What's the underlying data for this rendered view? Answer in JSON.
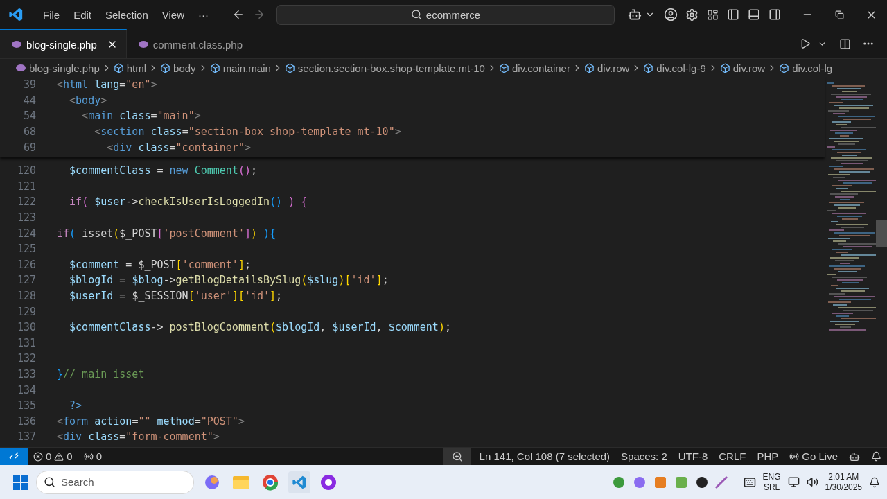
{
  "menu": [
    "File",
    "Edit",
    "Selection",
    "View",
    "···"
  ],
  "command_center": {
    "value": "ecommerce"
  },
  "tabs": [
    {
      "label": "blog-single.php",
      "selected": true
    },
    {
      "label": "comment.class.php",
      "selected": false
    }
  ],
  "breadcrumbs": [
    {
      "label": "blog-single.php",
      "kind": "file"
    },
    {
      "label": "html",
      "kind": "element"
    },
    {
      "label": "body",
      "kind": "element"
    },
    {
      "label": "main.main",
      "kind": "element"
    },
    {
      "label": "section.section-box.shop-template.mt-10",
      "kind": "element"
    },
    {
      "label": "div.container",
      "kind": "element"
    },
    {
      "label": "div.row",
      "kind": "element"
    },
    {
      "label": "div.col-lg-9",
      "kind": "element"
    },
    {
      "label": "div.row",
      "kind": "element"
    },
    {
      "label": "div.col-lg",
      "kind": "element"
    }
  ],
  "sticky_lines": [
    {
      "number": "39",
      "tokens": [
        {
          "text": "<",
          "kind": "tagp"
        },
        {
          "text": "html ",
          "kind": "tag"
        },
        {
          "text": "lang",
          "kind": "attr"
        },
        {
          "text": "=",
          "kind": "plain"
        },
        {
          "text": "\"en\"",
          "kind": "str"
        },
        {
          "text": ">",
          "kind": "tagp"
        }
      ]
    },
    {
      "number": "44",
      "tokens": [
        {
          "text": "  <",
          "kind": "tagp"
        },
        {
          "text": "body",
          "kind": "tag"
        },
        {
          "text": ">",
          "kind": "tagp"
        }
      ]
    },
    {
      "number": "54",
      "tokens": [
        {
          "text": "    <",
          "kind": "tagp"
        },
        {
          "text": "main ",
          "kind": "tag"
        },
        {
          "text": "class",
          "kind": "attr"
        },
        {
          "text": "=",
          "kind": "plain"
        },
        {
          "text": "\"main\"",
          "kind": "str"
        },
        {
          "text": ">",
          "kind": "tagp"
        }
      ]
    },
    {
      "number": "68",
      "tokens": [
        {
          "text": "      <",
          "kind": "tagp"
        },
        {
          "text": "section ",
          "kind": "tag"
        },
        {
          "text": "class",
          "kind": "attr"
        },
        {
          "text": "=",
          "kind": "plain"
        },
        {
          "text": "\"section-box shop-template mt-10\"",
          "kind": "str"
        },
        {
          "text": ">",
          "kind": "tagp"
        }
      ]
    },
    {
      "number": "69",
      "tokens": [
        {
          "text": "        <",
          "kind": "tagp"
        },
        {
          "text": "div ",
          "kind": "tag"
        },
        {
          "text": "class",
          "kind": "attr"
        },
        {
          "text": "=",
          "kind": "plain"
        },
        {
          "text": "\"container\"",
          "kind": "str"
        },
        {
          "text": ">",
          "kind": "tagp"
        }
      ]
    }
  ],
  "lines": [
    {
      "number": "120",
      "tokens": [
        {
          "text": "  $commentClass",
          "kind": "var"
        },
        {
          "text": " = ",
          "kind": "plain"
        },
        {
          "text": "new ",
          "kind": "kw"
        },
        {
          "text": "Comment",
          "kind": "cls"
        },
        {
          "text": "()",
          "kind": "b2"
        },
        {
          "text": ";",
          "kind": "plain"
        }
      ]
    },
    {
      "number": "121"
    },
    {
      "number": "122",
      "tokens": [
        {
          "text": "  if",
          "kind": "ctrl"
        },
        {
          "text": "( ",
          "kind": "b2"
        },
        {
          "text": "$user",
          "kind": "var"
        },
        {
          "text": "->",
          "kind": "plain"
        },
        {
          "text": "checkIsUserIsLoggedIn",
          "kind": "fn"
        },
        {
          "text": "() ",
          "kind": "b3"
        },
        {
          "text": ") {",
          "kind": "b2"
        }
      ]
    },
    {
      "number": "123"
    },
    {
      "number": "124",
      "tokens": [
        {
          "text": "if",
          "kind": "ctrl"
        },
        {
          "text": "( ",
          "kind": "b3"
        },
        {
          "text": "isset",
          "kind": "plain"
        },
        {
          "text": "(",
          "kind": "b1"
        },
        {
          "text": "$_POST",
          "kind": "plain"
        },
        {
          "text": "[",
          "kind": "b2"
        },
        {
          "text": "'postComment'",
          "kind": "str"
        },
        {
          "text": "]",
          "kind": "b2"
        },
        {
          "text": ") ",
          "kind": "b1"
        },
        {
          "text": "){",
          "kind": "b3"
        }
      ]
    },
    {
      "number": "125"
    },
    {
      "number": "126",
      "tokens": [
        {
          "text": "  $comment",
          "kind": "var"
        },
        {
          "text": " = ",
          "kind": "plain"
        },
        {
          "text": "$_POST",
          "kind": "plain"
        },
        {
          "text": "[",
          "kind": "b1"
        },
        {
          "text": "'comment'",
          "kind": "str"
        },
        {
          "text": "]",
          "kind": "b1"
        },
        {
          "text": ";",
          "kind": "plain"
        }
      ]
    },
    {
      "number": "127",
      "tokens": [
        {
          "text": "  $blogId",
          "kind": "var"
        },
        {
          "text": " = ",
          "kind": "plain"
        },
        {
          "text": "$blog",
          "kind": "var"
        },
        {
          "text": "->",
          "kind": "plain"
        },
        {
          "text": "getBlogDetailsBySlug",
          "kind": "fn"
        },
        {
          "text": "(",
          "kind": "b1"
        },
        {
          "text": "$slug",
          "kind": "var"
        },
        {
          "text": ")",
          "kind": "b1"
        },
        {
          "text": "[",
          "kind": "b1"
        },
        {
          "text": "'id'",
          "kind": "str"
        },
        {
          "text": "]",
          "kind": "b1"
        },
        {
          "text": ";",
          "kind": "plain"
        }
      ]
    },
    {
      "number": "128",
      "tokens": [
        {
          "text": "  $userId",
          "kind": "var"
        },
        {
          "text": " = ",
          "kind": "plain"
        },
        {
          "text": "$_SESSION",
          "kind": "plain"
        },
        {
          "text": "[",
          "kind": "b1"
        },
        {
          "text": "'user'",
          "kind": "str"
        },
        {
          "text": "]",
          "kind": "b1"
        },
        {
          "text": "[",
          "kind": "b1"
        },
        {
          "text": "'id'",
          "kind": "str"
        },
        {
          "text": "]",
          "kind": "b1"
        },
        {
          "text": ";",
          "kind": "plain"
        }
      ]
    },
    {
      "number": "129"
    },
    {
      "number": "130",
      "tokens": [
        {
          "text": "  $commentClass",
          "kind": "var"
        },
        {
          "text": "-> ",
          "kind": "plain"
        },
        {
          "text": "postBlogCoomment",
          "kind": "fn"
        },
        {
          "text": "(",
          "kind": "b1"
        },
        {
          "text": "$blogId",
          "kind": "var"
        },
        {
          "text": ", ",
          "kind": "plain"
        },
        {
          "text": "$userId",
          "kind": "var"
        },
        {
          "text": ", ",
          "kind": "plain"
        },
        {
          "text": "$comment",
          "kind": "var"
        },
        {
          "text": ")",
          "kind": "b1"
        },
        {
          "text": ";",
          "kind": "plain"
        }
      ]
    },
    {
      "number": "131"
    },
    {
      "number": "132"
    },
    {
      "number": "133",
      "tokens": [
        {
          "text": "}",
          "kind": "b3"
        },
        {
          "text": "// main isset",
          "kind": "cmt"
        }
      ]
    },
    {
      "number": "134"
    },
    {
      "number": "135",
      "tokens": [
        {
          "text": "  ?>",
          "kind": "kw"
        }
      ]
    },
    {
      "number": "136",
      "tokens": [
        {
          "text": "<",
          "kind": "tagp"
        },
        {
          "text": "form ",
          "kind": "tag"
        },
        {
          "text": "action",
          "kind": "attr"
        },
        {
          "text": "=",
          "kind": "plain"
        },
        {
          "text": "\"\" ",
          "kind": "str"
        },
        {
          "text": "method",
          "kind": "attr"
        },
        {
          "text": "=",
          "kind": "plain"
        },
        {
          "text": "\"POST\"",
          "kind": "str"
        },
        {
          "text": ">",
          "kind": "tagp"
        }
      ]
    },
    {
      "number": "137",
      "tokens": [
        {
          "text": "<",
          "kind": "tagp"
        },
        {
          "text": "div ",
          "kind": "tag"
        },
        {
          "text": "class",
          "kind": "attr"
        },
        {
          "text": "=",
          "kind": "plain"
        },
        {
          "text": "\"form-comment\"",
          "kind": "str"
        },
        {
          "text": ">",
          "kind": "tagp"
        }
      ]
    }
  ],
  "status_bar": {
    "errors": "0",
    "warnings": "0",
    "ports": "0",
    "items": [
      {
        "text": "Ln 141, Col 108 (7 selected)",
        "kind": "plain"
      },
      {
        "text": "Spaces: 2",
        "kind": "plain"
      },
      {
        "text": "UTF-8",
        "kind": "plain"
      },
      {
        "text": "CRLF",
        "kind": "plain"
      },
      {
        "text": "PHP",
        "kind": "plain"
      },
      {
        "text": "Go Live",
        "kind": "live"
      }
    ]
  },
  "taskbar": {
    "search": {
      "placeholder": "Search"
    },
    "language": [
      "ENG",
      "SRL"
    ],
    "time": "2:01 AM",
    "date": "1/30/2025"
  }
}
